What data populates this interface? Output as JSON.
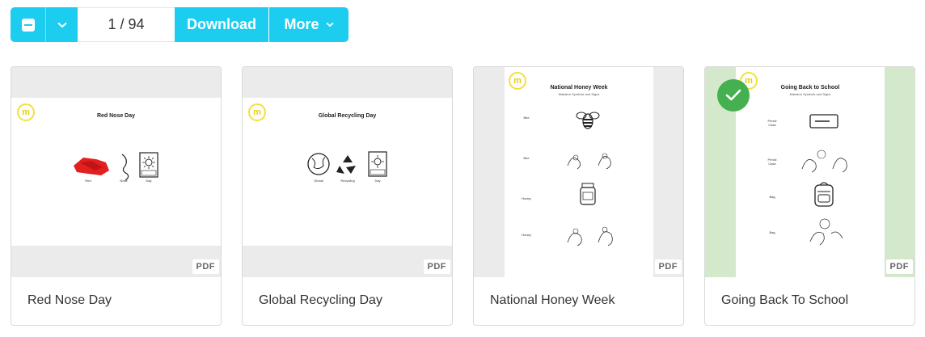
{
  "toolbar": {
    "page_indicator": "1 / 94",
    "download_label": "Download",
    "more_label": "More"
  },
  "cards": [
    {
      "title": "Red Nose Day",
      "badge": "PDF",
      "doc_title": "Red Nose Day",
      "symbols": [
        "Red",
        "Nose",
        "Day"
      ],
      "selected": false
    },
    {
      "title": "Global Recycling Day",
      "badge": "PDF",
      "doc_title": "Global Recycling Day",
      "symbols": [
        "Global",
        "Recycling",
        "Day"
      ],
      "selected": false
    },
    {
      "title": "National Honey Week",
      "badge": "PDF",
      "doc_title": "National Honey Week",
      "doc_subtitle": "Makaton Symbols and Signs",
      "symbols": [
        "Bee",
        "Bee",
        "Honey",
        "Honey"
      ],
      "selected": false
    },
    {
      "title": "Going Back To School",
      "badge": "PDF",
      "doc_title": "Going Back to School",
      "doc_subtitle": "Makaton Symbols and Signs",
      "symbols": [
        "Pencil Case",
        "Pencil Case",
        "Bag",
        "Bag"
      ],
      "selected": true
    }
  ],
  "colors": {
    "accent": "#1ccdf0",
    "selected_check": "#45b04f",
    "selected_bg": "#d4e9cc",
    "logo_yellow": "#f2e13c"
  },
  "icons": [
    "minus-square-icon",
    "chevron-down-icon",
    "check-icon",
    "makaton-logo"
  ]
}
